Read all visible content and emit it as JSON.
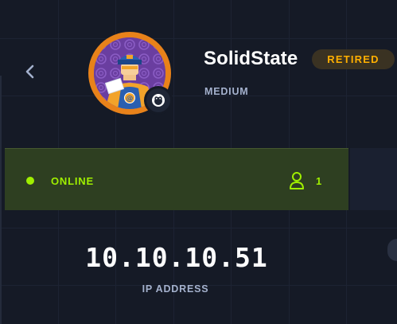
{
  "machine": {
    "name": "SolidState",
    "status_badge": "RETIRED",
    "difficulty": "MEDIUM",
    "avatar_icon": "mailman-avatar",
    "os_icon": "linux-penguin-icon"
  },
  "status": {
    "label": "ONLINE",
    "player_count": "1",
    "user_icon": "user-icon"
  },
  "network": {
    "ip": "10.10.10.51",
    "ip_label": "IP ADDRESS"
  },
  "colors": {
    "background": "#151a26",
    "accent_green": "#9fef00",
    "retired_orange": "#ffaf00",
    "status_panel": "#2e3f21",
    "muted_text": "#a4b1cd"
  }
}
